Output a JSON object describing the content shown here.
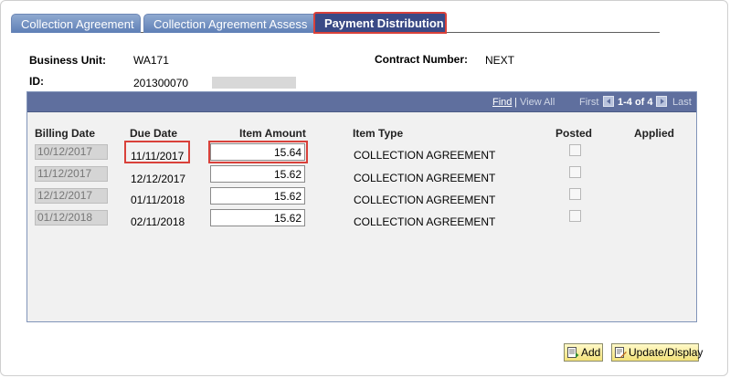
{
  "tabs": [
    {
      "label": "Collection Agreement",
      "active": false
    },
    {
      "label": "Collection Agreement Assess",
      "active": false
    },
    {
      "label": "Payment Distribution",
      "active": true
    }
  ],
  "header": {
    "business_unit_label": "Business Unit:",
    "business_unit_value": "WA171",
    "id_label": "ID:",
    "id_value": "201300070",
    "contract_number_label": "Contract Number:",
    "contract_number_value": "NEXT"
  },
  "grid_nav": {
    "find": "Find",
    "separator": "|",
    "view_all": "View All",
    "first": "First",
    "range": "1-4 of 4",
    "last": "Last"
  },
  "columns": {
    "billing_date": "Billing Date",
    "due_date": "Due Date",
    "item_amount": "Item Amount",
    "item_type": "Item Type",
    "posted": "Posted",
    "applied": "Applied"
  },
  "rows": [
    {
      "billing_date": "10/12/2017",
      "due_date": "11/11/2017",
      "item_amount": "15.64",
      "item_type": "COLLECTION AGREEMENT",
      "posted": false
    },
    {
      "billing_date": "11/12/2017",
      "due_date": "12/12/2017",
      "item_amount": "15.62",
      "item_type": "COLLECTION AGREEMENT",
      "posted": false
    },
    {
      "billing_date": "12/12/2017",
      "due_date": "01/11/2018",
      "item_amount": "15.62",
      "item_type": "COLLECTION AGREEMENT",
      "posted": false
    },
    {
      "billing_date": "01/12/2018",
      "due_date": "02/11/2018",
      "item_amount": "15.62",
      "item_type": "COLLECTION AGREEMENT",
      "posted": false
    }
  ],
  "buttons": {
    "add": "Add",
    "update_display": "Update/Display"
  },
  "colors": {
    "tab_active_bg": "#3a4a86",
    "tab_inactive_bg": "#6f8ec4",
    "grid_header_bg": "#5f6f9e",
    "highlight": "#d9413a",
    "button_bg": "#f3e27a"
  },
  "icons": {
    "find_prev": "arrow-left-icon",
    "find_next": "arrow-right-icon",
    "add": "add-icon",
    "update": "update-display-icon"
  }
}
